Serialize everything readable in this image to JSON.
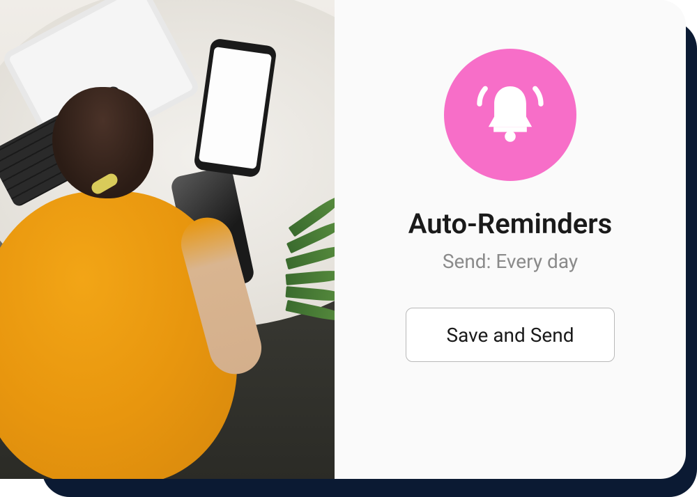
{
  "card": {
    "icon_name": "bell",
    "icon_bg_color": "#f76ec8",
    "title": "Auto-Reminders",
    "subtitle": "Send: Every day",
    "button_label": "Save and Send"
  }
}
